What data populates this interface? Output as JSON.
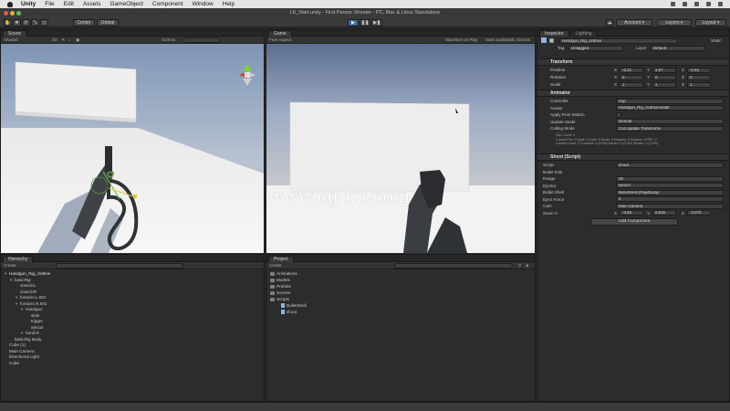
{
  "menubar": {
    "items": [
      "Unity",
      "File",
      "Edit",
      "Assets",
      "GameObject",
      "Component",
      "Window",
      "Help"
    ]
  },
  "window": {
    "title": "L6_Start.unity - First Person Shooter - PC, Mac & Linux Standalone"
  },
  "toolbar": {
    "pivot": "Center",
    "space": "Global",
    "account": "Account",
    "layers": "Layers",
    "layout": "Layout"
  },
  "scene": {
    "tab": "Scene",
    "shading": "Shaded",
    "mode": "2D",
    "gizmos": "Gizmos"
  },
  "game": {
    "tab": "Game",
    "aspect": "Free Aspect",
    "maximize": "Maximize on Play",
    "mute": "Mute audio",
    "stats": "Stats",
    "gizmos": "Gizmos"
  },
  "hierarchy": {
    "tab": "Hierarchy",
    "create": "Create",
    "items": [
      {
        "label": "Handgun_Rig_clothes",
        "depth": 0
      },
      {
        "label": "basicRig",
        "depth": 1
      },
      {
        "label": "claviclcL",
        "depth": 2
      },
      {
        "label": "claviclcR",
        "depth": 2
      },
      {
        "label": "forearm.L.001",
        "depth": 2
      },
      {
        "label": "forearm.R.001",
        "depth": 2
      },
      {
        "label": "Handgun",
        "depth": 3
      },
      {
        "label": "slide",
        "depth": 4
      },
      {
        "label": "trigger",
        "depth": 4
      },
      {
        "label": "ejector",
        "depth": 4
      },
      {
        "label": "hand.R",
        "depth": 3
      },
      {
        "label": "basicRig Body",
        "depth": 1
      },
      {
        "label": "Cube (1)",
        "depth": 0
      },
      {
        "label": "Main Camera",
        "depth": 0
      },
      {
        "label": "Directional Light",
        "depth": 0
      },
      {
        "label": "Cube",
        "depth": 0
      }
    ]
  },
  "project": {
    "tab": "Project",
    "create": "Create",
    "items": [
      {
        "label": "Animations",
        "depth": 0,
        "type": "folder"
      },
      {
        "label": "Models",
        "depth": 0,
        "type": "folder"
      },
      {
        "label": "Prefabs",
        "depth": 0,
        "type": "folder"
      },
      {
        "label": "Scenes",
        "depth": 0,
        "type": "folder"
      },
      {
        "label": "Scripts",
        "depth": 0,
        "type": "folder"
      },
      {
        "label": "BulletShell",
        "depth": 1,
        "type": "script"
      },
      {
        "label": "shoot",
        "depth": 1,
        "type": "script"
      }
    ]
  },
  "inspector": {
    "tabs": [
      "Inspector",
      "Lighting"
    ],
    "object_name": "Handgun_Rig_clothes",
    "static": "Static",
    "tag_label": "Tag",
    "tag_value": "Untagged",
    "layer_label": "Layer",
    "layer_value": "Default",
    "transform": {
      "header": "Transform",
      "rows": [
        {
          "label": "Position",
          "x": "-0.21",
          "y": "1.57",
          "z": "-1.61"
        },
        {
          "label": "Rotation",
          "x": "0",
          "y": "0",
          "z": "0"
        },
        {
          "label": "Scale",
          "x": "1",
          "y": "1",
          "z": "1"
        }
      ]
    },
    "animator": {
      "header": "Animator",
      "rows": [
        {
          "label": "Controller",
          "value": "Clip"
        },
        {
          "label": "Avatar",
          "value": "Handgun_Rig_clothesAvatar"
        },
        {
          "label": "Apply Root Motion",
          "value": ""
        },
        {
          "label": "Update Mode",
          "value": "Normal"
        },
        {
          "label": "Culling Mode",
          "value": "Cull Update Transforms"
        }
      ],
      "info": [
        "Clip Count: 0",
        "Curves Pos: 0 Quat: 0 Euler: 0 Scale: 0 Muscles: 0 Generic: 0 PPtr: 0",
        "Curves Count: 0 Constant: 0 (0.0%) Dense: 0 (0.0%) Stream: 0 (0.0%)"
      ]
    },
    "shoot": {
      "header": "Shoot (Script)",
      "rows": [
        {
          "label": "Script",
          "value": "shoot"
        },
        {
          "label": "Bullet hole",
          "value": ""
        },
        {
          "label": "Range",
          "value": "25"
        },
        {
          "label": "Ejector",
          "value": "ejector"
        },
        {
          "label": "Bullet Shell",
          "value": "BulletShell (Rigidbody)"
        },
        {
          "label": "Eject Force",
          "value": "5"
        },
        {
          "label": "Cam",
          "value": "Main Camera"
        }
      ],
      "zoom_row": {
        "label": "Zoom V",
        "x": "-0.86",
        "y": "0.516",
        "z": "-3.072"
      }
    },
    "add_component": "Add Component"
  },
  "watermark": "www.cg-ku.com",
  "colors": {
    "accent": "#3d6aa8",
    "panel": "#2c2c2c",
    "sky_top": "#96a8c4",
    "floor": "#f1f1f1"
  }
}
